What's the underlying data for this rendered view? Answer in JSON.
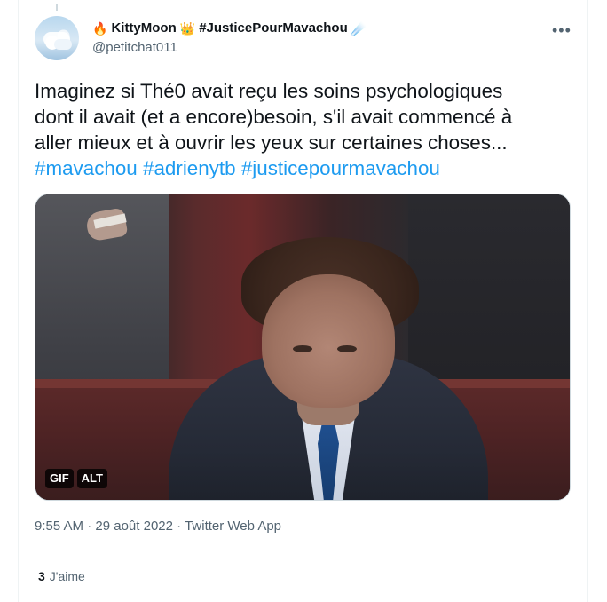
{
  "author": {
    "fire_emoji": "🔥",
    "display_name": "KittyMoon",
    "crown_emoji": "👑",
    "hashtag_name": "#JusticePourMavachou",
    "comet_emoji": "☄️",
    "handle": "@petitchat011"
  },
  "menu": {
    "more_label": "•••"
  },
  "tweet": {
    "lines": [
      "Imaginez si Thé0 avait reçu les soins psychologiques",
      "dont il avait (et a encore)besoin, s'il avait commencé à",
      "aller mieux et à ouvrir les yeux sur certaines choses..."
    ],
    "hashtags": [
      "#mavachou",
      "#adrienytb",
      "#justicepourmavachou"
    ]
  },
  "media": {
    "badges": [
      "GIF",
      "ALT"
    ]
  },
  "meta": {
    "time": "9:55 AM",
    "separator": "·",
    "date": "29 août 2022",
    "app": "Twitter Web App"
  },
  "stats": {
    "likes_count": "3",
    "likes_label": "J'aime"
  }
}
